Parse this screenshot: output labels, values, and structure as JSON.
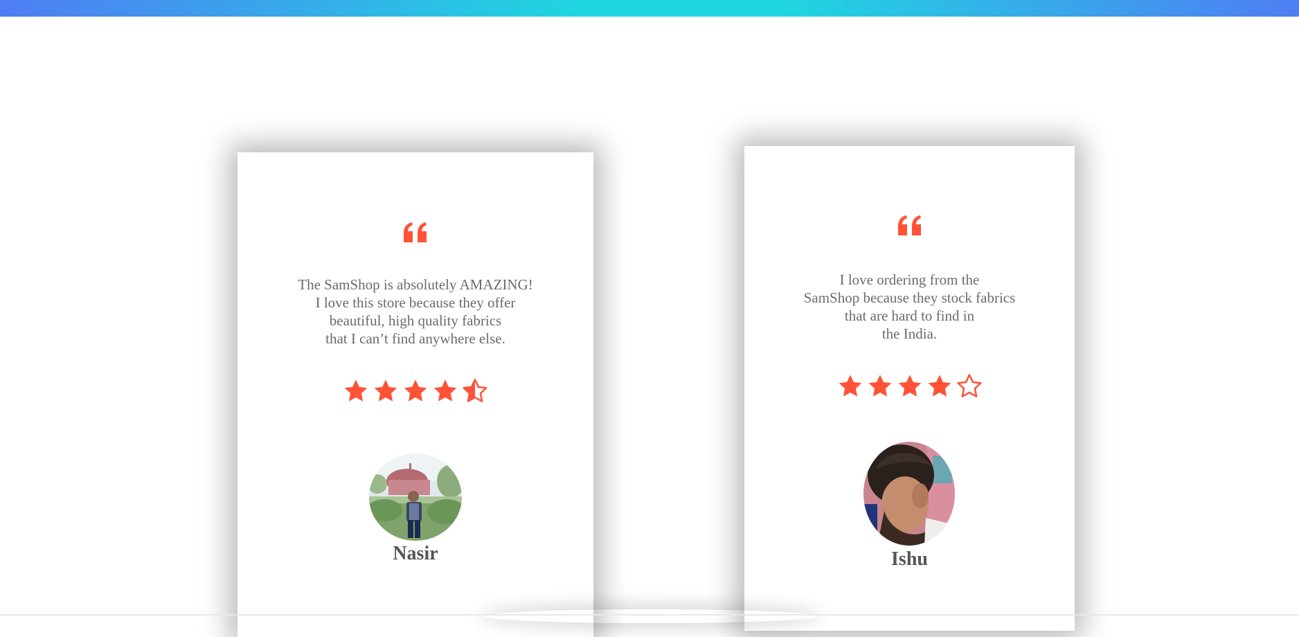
{
  "colors": {
    "accent": "#ff5236",
    "text": "#6b6b6b",
    "name": "#555555",
    "gradient_start": "#4f7df3",
    "gradient_mid": "#1fd6e0"
  },
  "testimonials": [
    {
      "quote_icon": "quote-left-icon",
      "lines": [
        "The SamShop is absolutely AMAZING!",
        "I love this store because they offer",
        "beautiful, high quality fabrics",
        "that I can’t find anywhere else."
      ],
      "rating": 4.5,
      "rating_max": 5,
      "name": "Nasir"
    },
    {
      "quote_icon": "quote-left-icon",
      "lines": [
        "I love ordering from the",
        "SamShop because they stock fabrics",
        "that are hard to find in",
        "the India."
      ],
      "rating": 4,
      "rating_max": 5,
      "name": "Ishu"
    }
  ]
}
